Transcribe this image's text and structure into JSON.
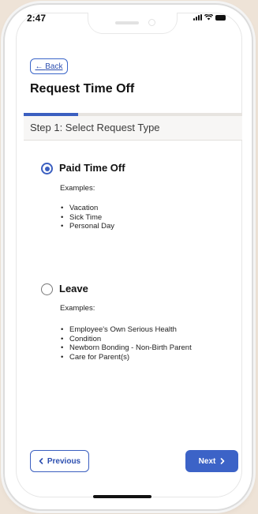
{
  "status_bar": {
    "time": "2:47"
  },
  "header": {
    "back_label": "Back",
    "back_arrow": "←",
    "title": "Request Time Off"
  },
  "progress": {
    "fraction": 0.25,
    "color": "#3b5fc0"
  },
  "step": {
    "label": "Step 1: Select Request Type"
  },
  "options": [
    {
      "label": "Paid Time Off",
      "selected": true,
      "examples_label": "Examples:",
      "examples": [
        "Vacation",
        "Sick Time",
        "Personal Day"
      ]
    },
    {
      "label": "Leave",
      "selected": false,
      "examples_label": "Examples:",
      "examples": [
        "Employee's Own Serious Health",
        "Condition",
        "Newborn Bonding - Non-Birth Parent",
        "Care for Parent(s)"
      ]
    }
  ],
  "footer": {
    "previous_label": "Previous",
    "previous_icon": "chevron-left-icon",
    "next_label": "Next",
    "next_icon": "chevron-right-icon"
  },
  "colors": {
    "accent": "#3b5fc0",
    "background": "#eee3d7"
  }
}
